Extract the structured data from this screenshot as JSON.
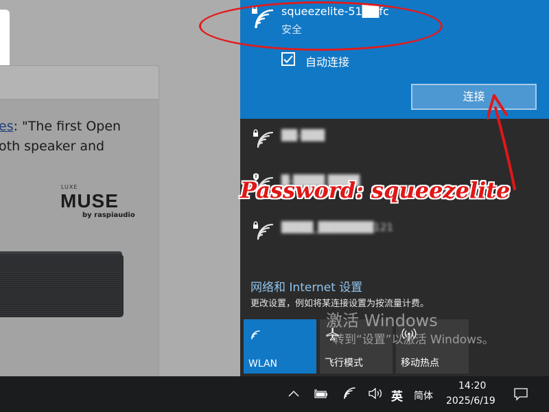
{
  "background_page": {
    "text_link": "es",
    "text_line1_rest": ": \"The first Open",
    "text_line2": "oth speaker and",
    "brand_small": "LUXE",
    "brand_name": "MUSE",
    "brand_by": "by raspiaudio"
  },
  "flyout": {
    "selected_network": {
      "name": "squeezelite-51██fc",
      "status": "安全",
      "auto_connect_label": "自动连接",
      "auto_connect_checked": true,
      "connect_button": "连接"
    },
    "networks": [
      {
        "name": "██-███",
        "secured": true,
        "icon": "wifi-lock-icon"
      },
      {
        "name": "█-████ ████",
        "secured": true,
        "icon": "wifi-shield-icon"
      },
      {
        "name": "████_███████121",
        "secured": true,
        "icon": "wifi-lock-icon"
      }
    ],
    "annotation": "Password: squeezelite",
    "settings_link": "网络和 Internet 设置",
    "settings_desc": "更改设置，例如将某连接设置为按流量计费。",
    "tiles": [
      {
        "label": "WLAN",
        "icon": "wifi-icon",
        "active": true
      },
      {
        "label": "飞行模式",
        "icon": "airplane-icon",
        "active": false
      },
      {
        "label": "移动热点",
        "icon": "hotspot-icon",
        "active": false
      }
    ],
    "watermark_line1": "激活 Windows",
    "watermark_line2": "转到“设置”以激活 Windows。"
  },
  "taskbar": {
    "ime_lang": "英",
    "ime_mode": "简体",
    "time": "14:20",
    "date": "2025/6/19"
  },
  "colors": {
    "accent": "#1178c6",
    "flyout_bg": "#2b2b2b",
    "annotation": "#e11616"
  }
}
